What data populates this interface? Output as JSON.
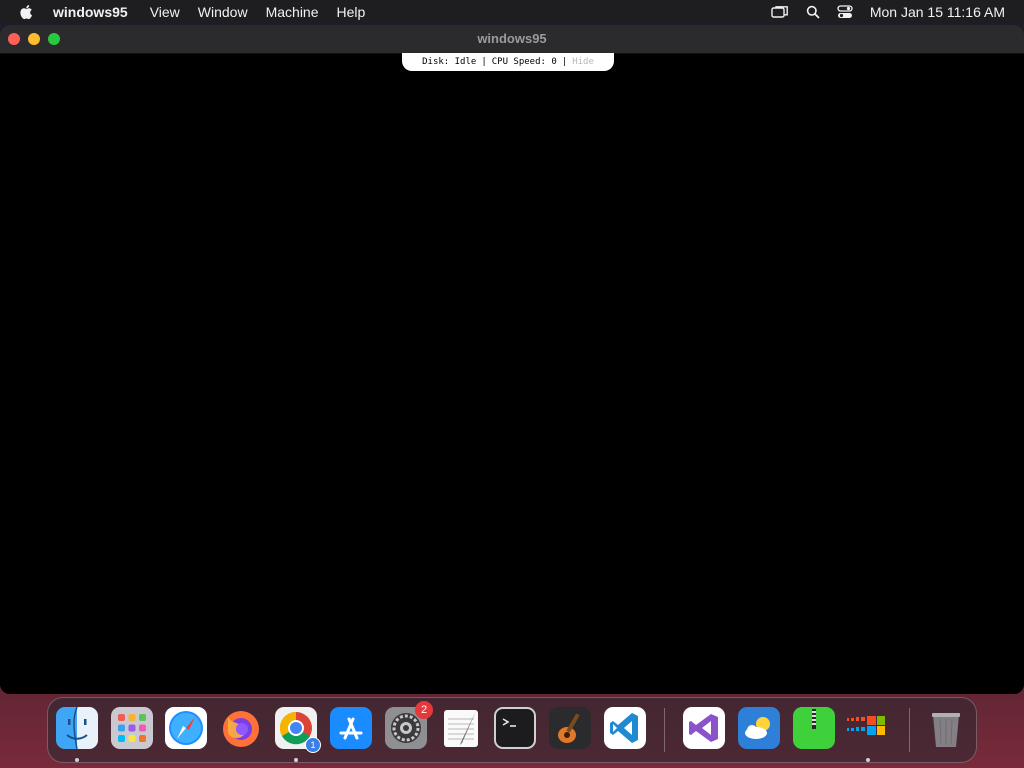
{
  "menubar": {
    "app_name": "windows95",
    "items": [
      "View",
      "Window",
      "Machine",
      "Help"
    ],
    "clock": "Mon Jan 15  11:16 AM",
    "icons": [
      "screen-mirroring-icon",
      "search-icon",
      "control-center-icon"
    ]
  },
  "window": {
    "title": "windows95",
    "status": {
      "disk": "Disk: Idle",
      "separator": "|",
      "cpu": "CPU Speed: 0",
      "hide": "Hide"
    }
  },
  "dock": {
    "apps": [
      {
        "name": "Finder",
        "icon": "finder-icon",
        "running": true
      },
      {
        "name": "Launchpad",
        "icon": "launchpad-icon",
        "running": false
      },
      {
        "name": "Safari",
        "icon": "safari-icon",
        "running": false
      },
      {
        "name": "Firefox",
        "icon": "firefox-icon",
        "running": false
      },
      {
        "name": "Google Chrome",
        "icon": "chrome-icon",
        "running": true,
        "badge": "1"
      },
      {
        "name": "App Store",
        "icon": "app-store-icon",
        "running": false
      },
      {
        "name": "System Settings",
        "icon": "settings-icon",
        "running": false,
        "badge": "2"
      },
      {
        "name": "TextEdit",
        "icon": "textedit-icon",
        "running": false
      },
      {
        "name": "Terminal",
        "icon": "terminal-icon",
        "running": false
      },
      {
        "name": "GarageBand",
        "icon": "garageband-icon",
        "running": false
      },
      {
        "name": "Visual Studio Code",
        "icon": "vscode-icon",
        "running": false
      },
      {
        "name": "Visual Studio",
        "icon": "visual-studio-icon",
        "running": false
      },
      {
        "name": "Weather",
        "icon": "weather-icon",
        "running": false
      },
      {
        "name": "Archive Utility",
        "icon": "archive-icon",
        "running": false
      },
      {
        "name": "windows95",
        "icon": "windows95-icon",
        "running": true
      },
      {
        "name": "Trash",
        "icon": "trash-icon",
        "running": false
      }
    ]
  }
}
